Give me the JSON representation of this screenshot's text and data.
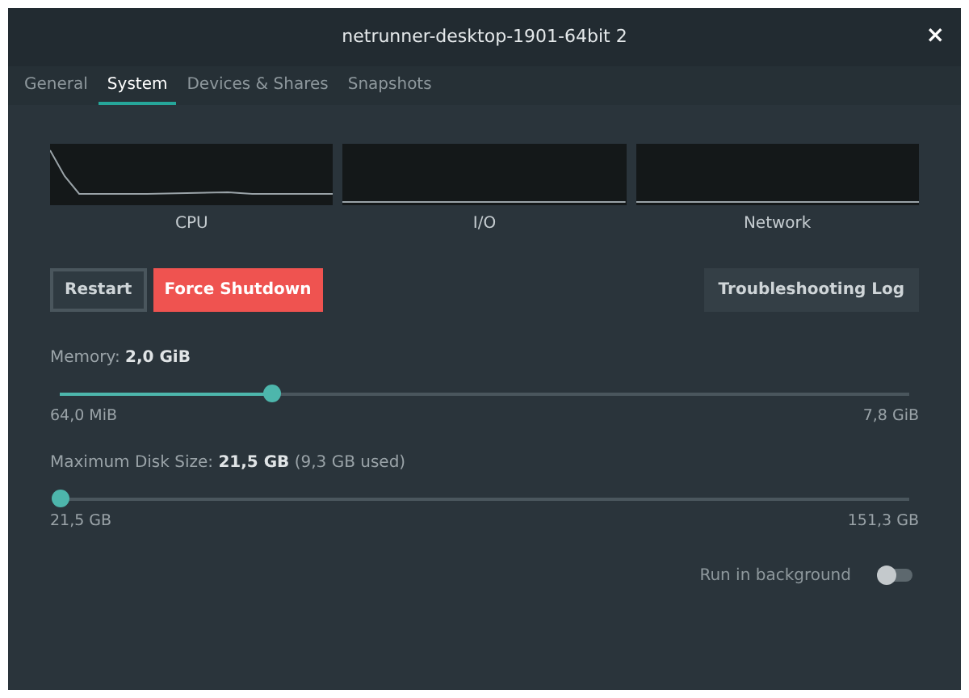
{
  "window": {
    "title": "netrunner-desktop-1901-64bit 2",
    "close": "×"
  },
  "tabs": [
    {
      "label": "General",
      "selected": false
    },
    {
      "label": "System",
      "selected": true
    },
    {
      "label": "Devices & Shares",
      "selected": false
    },
    {
      "label": "Snapshots",
      "selected": false
    }
  ],
  "graphs": [
    {
      "label": "CPU"
    },
    {
      "label": "I/O"
    },
    {
      "label": "Network"
    }
  ],
  "buttons": [
    {
      "label": "Restart",
      "kind": "outline"
    },
    {
      "label": "Force Shutdown",
      "kind": "danger"
    },
    {
      "label": "Troubleshooting Log",
      "kind": "plain"
    }
  ],
  "sliders": [
    {
      "label": "Memory: **2,0 GiB**",
      "level": 0.25,
      "min": "64,0 MiB",
      "max": "7,8 GiB"
    },
    {
      "label": "Maximum Disk Size: **21,5 GB** (9,3 GB used)",
      "level": 0,
      "min": "21,5 GB",
      "max": "151,3 GB"
    }
  ],
  "run_in_background": {
    "label": "Run in background",
    "on": false
  }
}
